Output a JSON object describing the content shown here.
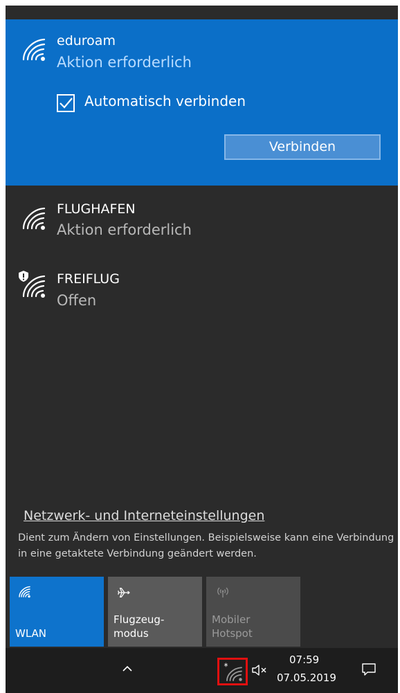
{
  "networks": {
    "selected": {
      "name": "eduroam",
      "status": "Aktion erforderlich",
      "auto_connect_label": "Automatisch verbinden",
      "auto_connect_checked": true,
      "connect_label": "Verbinden",
      "icon": "wifi-secured-icon"
    },
    "items": [
      {
        "name": "FLUGHAFEN",
        "status": "Aktion erforderlich",
        "icon": "wifi-icon"
      },
      {
        "name": "FREIFLUG",
        "status": "Offen",
        "icon": "wifi-open-shield-icon"
      }
    ]
  },
  "settings": {
    "link": "Netzwerk- und Interneteinstellungen",
    "description": "Dient zum Ändern von Einstellungen. Beispielsweise kann eine Verbindung in eine getaktete Verbindung geändert werden."
  },
  "quick_actions": [
    {
      "label": "WLAN",
      "icon": "wifi-icon",
      "state": "on"
    },
    {
      "label_line1": "Flugzeug-",
      "label_line2": "modus",
      "icon": "airplane-icon",
      "state": "off"
    },
    {
      "label_line1": "Mobiler",
      "label_line2": "Hotspot",
      "icon": "hotspot-icon",
      "state": "disabled"
    }
  ],
  "taskbar": {
    "time": "07:59",
    "date": "07.05.2019",
    "icons": [
      "chevron-up-icon",
      "network-icon",
      "speaker-muted-icon",
      "action-center-icon"
    ]
  },
  "colors": {
    "accent": "#0b6fc8",
    "flyout_bg": "#2b2b2b",
    "taskbar_bg": "#1d1d1d",
    "highlight_box": "#e01010"
  }
}
